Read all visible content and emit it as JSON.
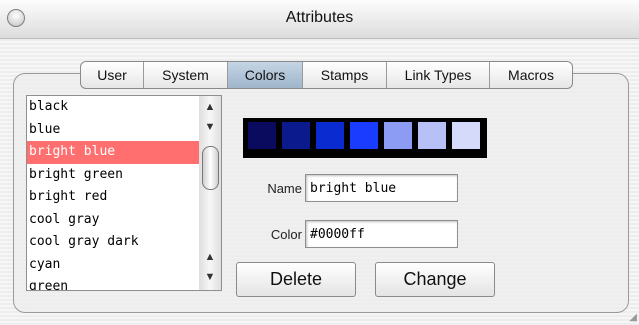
{
  "window": {
    "title": "Attributes"
  },
  "tabs": [
    {
      "label": "User"
    },
    {
      "label": "System"
    },
    {
      "label": "Colors"
    },
    {
      "label": "Stamps"
    },
    {
      "label": "Link Types"
    },
    {
      "label": "Macros"
    }
  ],
  "active_tab": "Colors",
  "color_list": {
    "items": [
      "black",
      "blue",
      "bright blue",
      "bright green",
      "bright red",
      "cool gray",
      "cool gray dark",
      "cyan",
      "green"
    ],
    "selected": "bright blue"
  },
  "swatches": [
    "#0a0a5e",
    "#0b1a8c",
    "#0a2bd0",
    "#1a3cff",
    "#8c9cf5",
    "#b7c0f7",
    "#d6dafa"
  ],
  "form": {
    "name_label": "Name",
    "name_value": "bright blue",
    "color_label": "Color",
    "color_value": "#0000ff"
  },
  "buttons": {
    "delete": "Delete",
    "change": "Change"
  },
  "colors": {
    "selection": "#ff6f6f",
    "active_tab": "#9fb5cb"
  }
}
